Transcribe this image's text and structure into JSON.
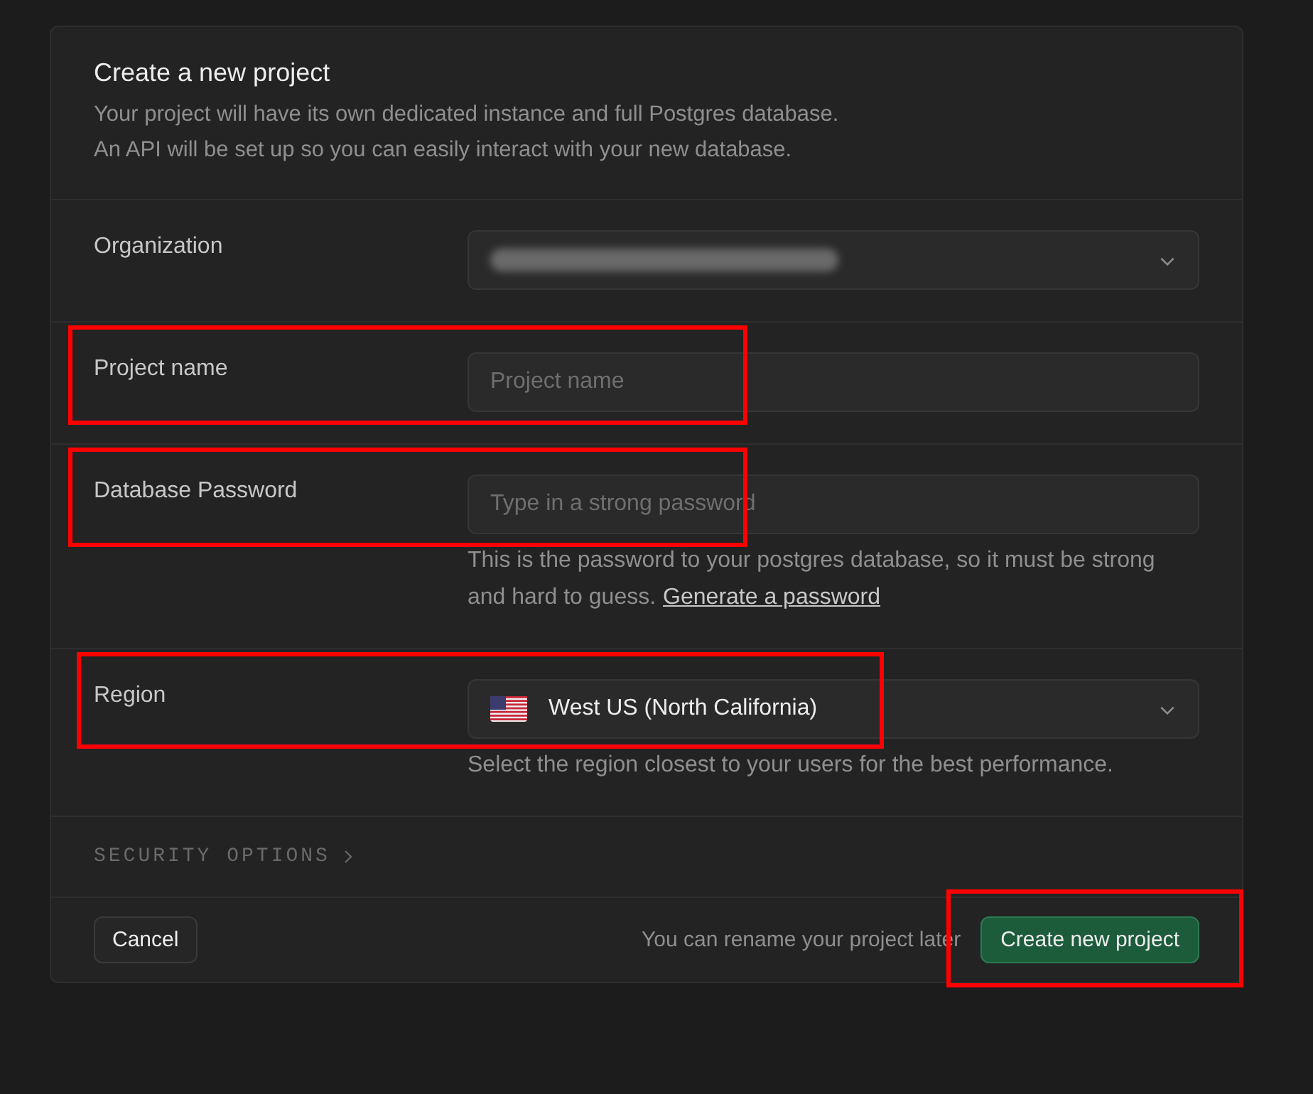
{
  "dialog": {
    "title": "Create a new project",
    "description": [
      "Your project will have its own dedicated instance and full Postgres database.",
      "An API will be set up so you can easily interact with your new database."
    ]
  },
  "fields": [
    {
      "label": "Organization",
      "kind": "select",
      "highlighted": false
    },
    {
      "label": "Project name",
      "kind": "input",
      "placeholder": "Project name",
      "highlighted": true
    },
    {
      "label": "Database Password",
      "kind": "input",
      "placeholder": "Type in a strong password",
      "help": "This is the password to your postgres database, so it must be strong and hard to guess.",
      "help_link": "Generate a password",
      "highlighted": true
    },
    {
      "label": "Region",
      "kind": "select",
      "value": "West US (North California)",
      "flag": true,
      "help": "Select the region closest to your users for the best performance.",
      "highlighted": true
    }
  ],
  "security_options": {
    "label": "SECURITY OPTIONS",
    "expanded": false
  },
  "footer": {
    "cancel": "Cancel",
    "note": "You can rename your project later",
    "submit": "Create new project",
    "submit_highlighted": true
  }
}
